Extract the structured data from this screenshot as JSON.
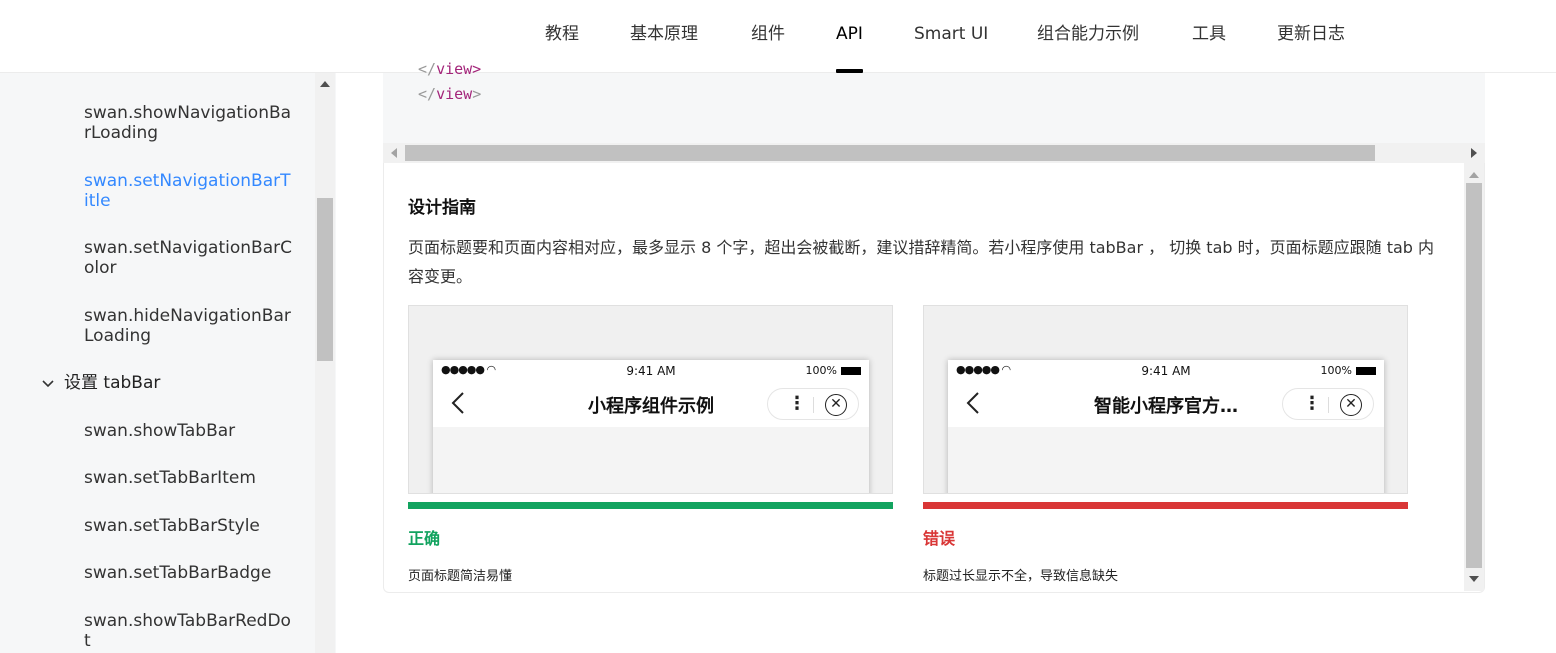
{
  "nav": {
    "items": [
      {
        "label": "教程",
        "active": false
      },
      {
        "label": "基本原理",
        "active": false
      },
      {
        "label": "组件",
        "active": false
      },
      {
        "label": "API",
        "active": true
      },
      {
        "label": "Smart UI",
        "active": false
      },
      {
        "label": "组合能力示例",
        "active": false
      },
      {
        "label": "工具",
        "active": false
      },
      {
        "label": "更新日志",
        "active": false
      }
    ]
  },
  "sidebar": {
    "items_top": [
      {
        "label": "swan.showNavigationBarLoading",
        "active": false
      },
      {
        "label": "swan.setNavigationBarTitle",
        "active": true
      },
      {
        "label": "swan.setNavigationBarColor",
        "active": false
      },
      {
        "label": "swan.hideNavigationBarLoading",
        "active": false
      }
    ],
    "group": {
      "label": "设置 tabBar",
      "expanded": true
    },
    "items_group": [
      {
        "label": "swan.showTabBar"
      },
      {
        "label": "swan.setTabBarItem"
      },
      {
        "label": "swan.setTabBarStyle"
      },
      {
        "label": "swan.setTabBarBadge"
      },
      {
        "label": "swan.showTabBarRedDot"
      }
    ]
  },
  "code": {
    "line_partial_open": "</",
    "line_partial_tag": "view>",
    "close_open": "</",
    "close_tag": "view",
    "close_end": ">"
  },
  "guide": {
    "title": "设计指南",
    "description": "页面标题要和页面内容相对应，最多显示 8 个字，超出会被截断，建议措辞精简。若小程序使用 tabBar ， 切换 tab 时，页面标题应跟随 tab 内容变更。",
    "examples": [
      {
        "phone_time": "9:41 AM",
        "phone_battery": "100%",
        "page_title": "小程序组件示例",
        "verdict": "正确",
        "verdict_color": "#12a35f",
        "caption": "页面标题简洁易懂"
      },
      {
        "phone_time": "9:41 AM",
        "phone_battery": "100%",
        "page_title": "智能小程序官方…",
        "verdict": "错误",
        "verdict_color": "#d93636",
        "caption": "标题过长显示不全，导致信息缺失"
      }
    ]
  },
  "colors": {
    "link_active": "#3388ff",
    "correct": "#12a35f",
    "wrong": "#d93636"
  }
}
